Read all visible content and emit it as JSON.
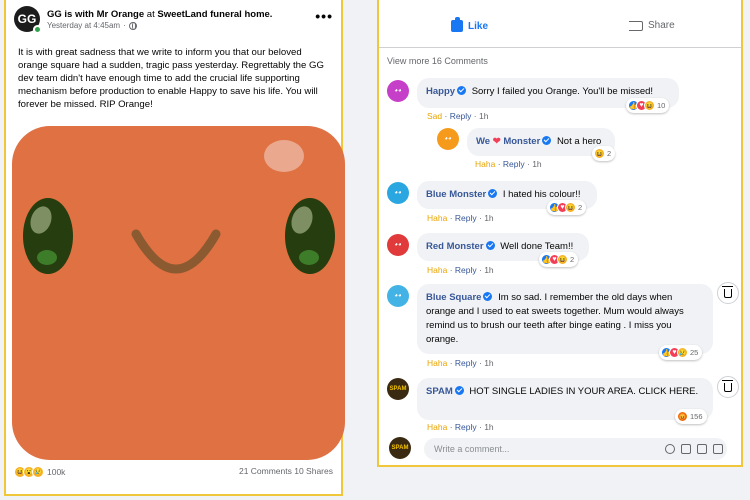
{
  "post": {
    "avatar_text": "GG",
    "header": {
      "author": "GG",
      "is_with": "is with",
      "friend": "Mr Orange",
      "at": "at",
      "place": "SweetLand funeral home."
    },
    "timestamp": "Yesterday at 4:45am",
    "more": "•••",
    "body": "It is with great sadness that we write to inform you that our beloved orange square had a sudden, tragic pass yesterday. Regrettably the GG dev team didn't have enough time to add the crucial life supporting mechanism before production to enable Happy to save his life. You will forever be missed. RIP Orange!",
    "reactions_count": "100k",
    "counts": "21 Comments 10 Shares"
  },
  "actions": {
    "like_label": "Like",
    "share_label": "Share"
  },
  "view_more": "View more 16 Comments",
  "comments": [
    {
      "name": "Happy",
      "text": "Sorry I failed you Orange. You'll be missed!",
      "reaction": "Sad",
      "reply": "Reply",
      "time": "1h",
      "count": "10",
      "avatar_color": "#c63fc8"
    },
    {
      "name_a": "We",
      "name_heart": "❤",
      "name_b": "Monster",
      "text": "Not a hero",
      "reaction": "Haha",
      "reply": "Reply",
      "time": "1h",
      "count": "2",
      "avatar_color": "#f59a1b"
    },
    {
      "name": "Blue Monster",
      "text": "I hated his colour!!",
      "reaction": "Haha",
      "reply": "Reply",
      "time": "1h",
      "count": "2",
      "avatar_color": "#2aa7e0"
    },
    {
      "name": "Red Monster",
      "text": "Well done Team!!",
      "reaction": "Haha",
      "reply": "Reply",
      "time": "1h",
      "count": "2",
      "avatar_color": "#e03a3a"
    },
    {
      "name": "Blue Square",
      "text": "Im so sad. I remember the old days when orange and I used to eat sweets together. Mum would always remind us to brush our teeth after binge eating . I miss you orange.",
      "reaction": "Haha",
      "reply": "Reply",
      "time": "1h",
      "count": "25",
      "avatar_color": "#43b3e6"
    },
    {
      "name": "SPAM",
      "text": "HOT SINGLE LADIES IN YOUR AREA. CLICK HERE.",
      "reaction": "Haha",
      "reply": "Reply",
      "time": "1h",
      "count": "156",
      "avatar_color": "#3a2a12",
      "avatar_text": "SPAM"
    }
  ],
  "input": {
    "placeholder": "Write a comment...",
    "avatar_text": "SPAM"
  }
}
